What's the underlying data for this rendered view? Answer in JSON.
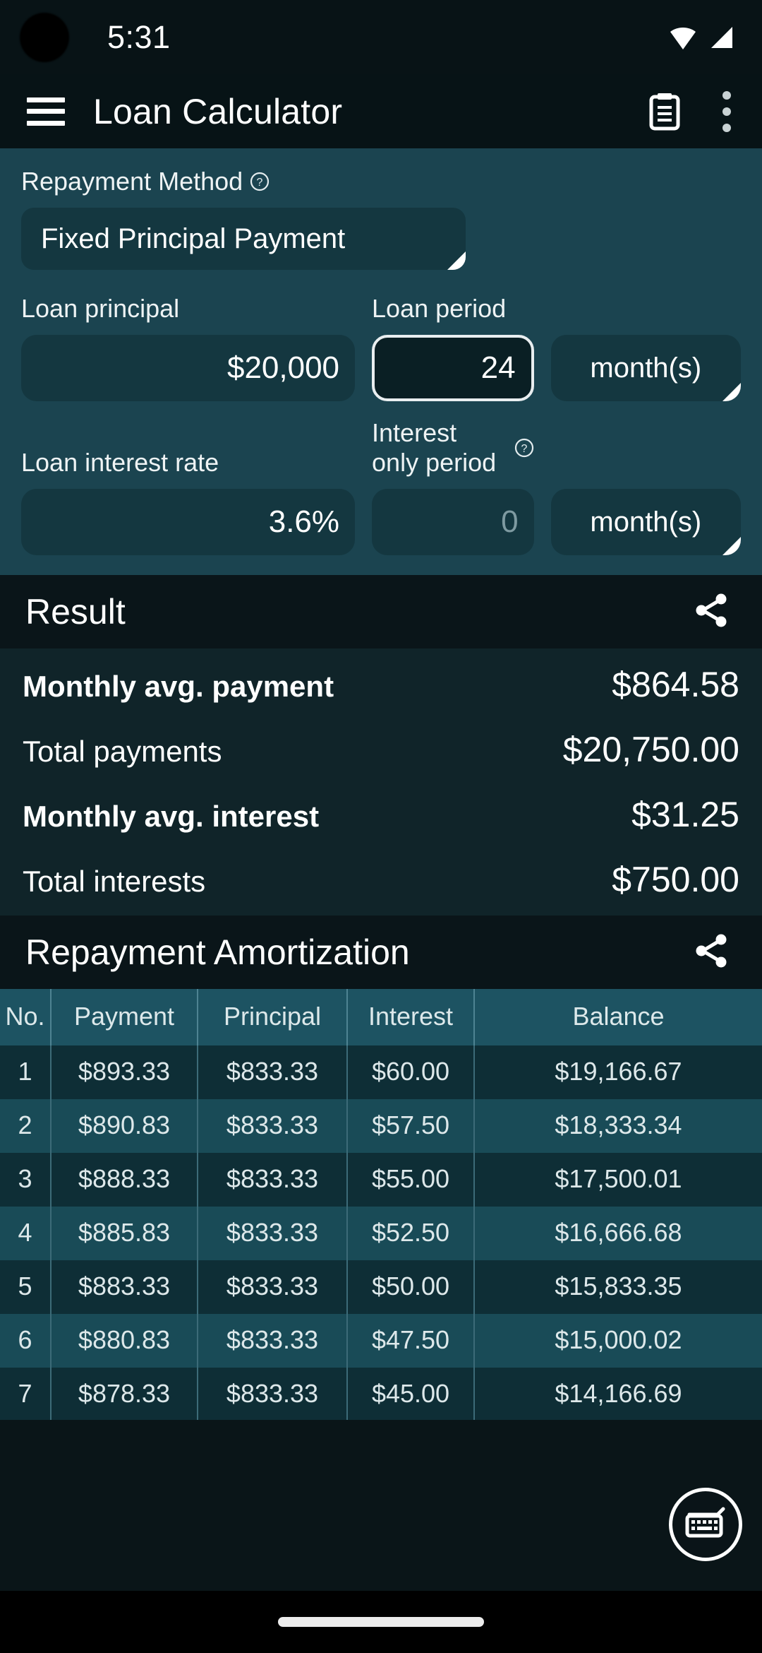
{
  "status_bar": {
    "time": "5:31",
    "icons": [
      "wifi-icon",
      "cellular-signal-icon"
    ]
  },
  "app_bar": {
    "menu_icon": "hamburger-menu-icon",
    "title": "Loan Calculator",
    "notes_icon": "clipboard-notes-icon",
    "overflow_icon": "overflow-menu-icon"
  },
  "form": {
    "repayment_method": {
      "label": "Repayment Method",
      "help_icon": "help-circle-icon",
      "value": "Fixed Principal Payment"
    },
    "loan_principal": {
      "label": "Loan principal",
      "value": "$20,000"
    },
    "loan_period": {
      "label": "Loan period",
      "value": "24",
      "unit": "month(s)"
    },
    "loan_interest_rate": {
      "label": "Loan interest rate",
      "value": "3.6%"
    },
    "interest_only_period": {
      "label": "Interest only period",
      "help_icon": "help-circle-icon",
      "placeholder": "0",
      "unit": "month(s)"
    }
  },
  "result": {
    "title": "Result",
    "share_icon": "share-icon",
    "rows": [
      {
        "label": "Monthly avg. payment",
        "value": "$864.58",
        "bold": true
      },
      {
        "label": "Total payments",
        "value": "$20,750.00",
        "bold": false
      },
      {
        "label": "Monthly avg. interest",
        "value": "$31.25",
        "bold": true
      },
      {
        "label": "Total interests",
        "value": "$750.00",
        "bold": false
      }
    ]
  },
  "amortization": {
    "title": "Repayment Amortization",
    "share_icon": "share-icon",
    "columns": [
      "No.",
      "Payment",
      "Principal",
      "Interest",
      "Balance"
    ],
    "rows": [
      [
        "1",
        "$893.33",
        "$833.33",
        "$60.00",
        "$19,166.67"
      ],
      [
        "2",
        "$890.83",
        "$833.33",
        "$57.50",
        "$18,333.34"
      ],
      [
        "3",
        "$888.33",
        "$833.33",
        "$55.00",
        "$17,500.01"
      ],
      [
        "4",
        "$885.83",
        "$833.33",
        "$52.50",
        "$16,666.68"
      ],
      [
        "5",
        "$883.33",
        "$833.33",
        "$50.00",
        "$15,833.35"
      ],
      [
        "6",
        "$880.83",
        "$833.33",
        "$47.50",
        "$15,000.02"
      ],
      [
        "7",
        "$878.33",
        "$833.33",
        "$45.00",
        "$14,166.69"
      ]
    ]
  },
  "fab": {
    "icon": "keyboard-icon"
  },
  "nav_bar": {
    "pill": "home-gesture-pill"
  },
  "colors": {
    "app_bar_bg": "#071316",
    "form_bg": "#1b4450",
    "field_bg": "#143740",
    "section_bg": "#0a1519",
    "result_bg": "#102429",
    "table_header_bg": "#1d5362",
    "row_odd_bg": "#0e2e36",
    "row_even_bg": "#194b57",
    "text": "#ffffff"
  }
}
